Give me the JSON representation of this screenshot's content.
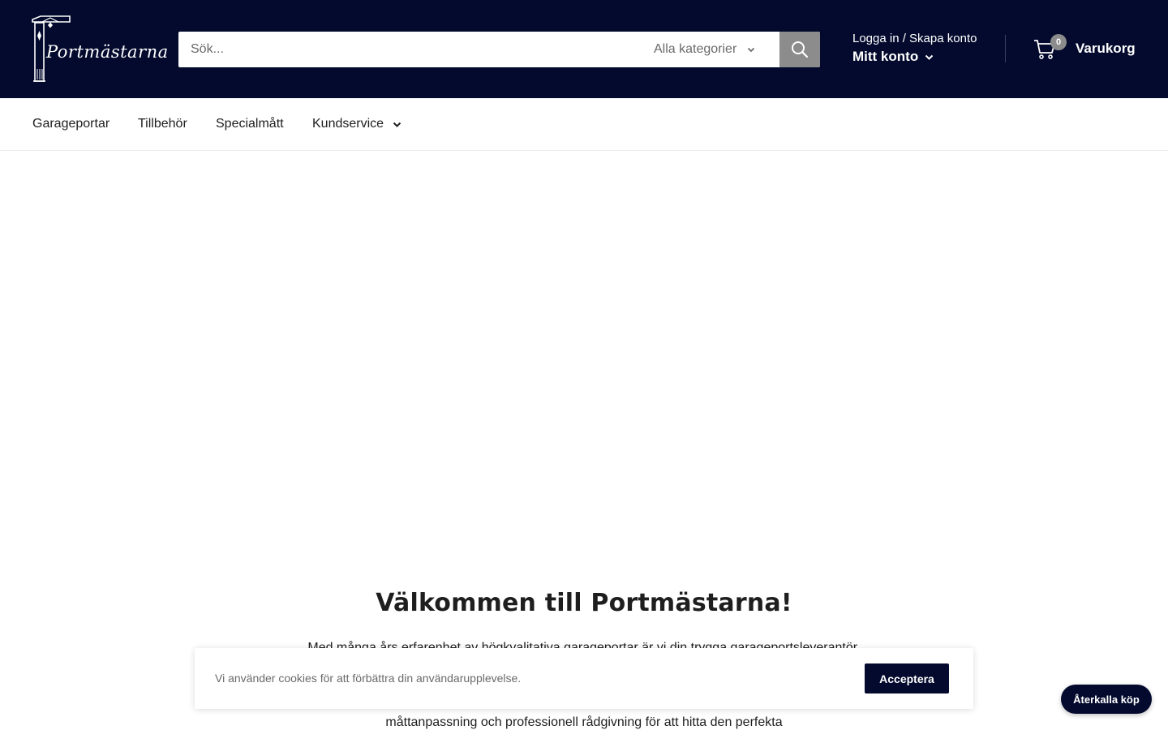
{
  "header": {
    "logo_text": "Portmästarna",
    "search": {
      "placeholder": "Sök...",
      "category_label": "Alla kategorier"
    },
    "account": {
      "login_text": "Logga in / Skapa konto",
      "account_label": "Mitt konto"
    },
    "cart": {
      "count": "0",
      "label": "Varukorg"
    }
  },
  "nav": {
    "items": [
      {
        "label": "Garageportar"
      },
      {
        "label": "Tillbehör"
      },
      {
        "label": "Specialmått"
      },
      {
        "label": "Kundservice"
      }
    ]
  },
  "main": {
    "welcome_title": "Välkommen till Portmästarna!",
    "intro_line_1": "Med många års erfarenhet av högkvalitativa garageportar är vi din trygga garageportsleverantör.",
    "intro_line_2": "måttanpassning och professionell rådgivning för att hitta den perfekta"
  },
  "cookie_banner": {
    "text": "Vi använder cookies för att förbättra din användarupplevelse.",
    "accept_label": "Acceptera"
  },
  "floating": {
    "recall_label": "Återkalla köp"
  },
  "colors": {
    "header_bg": "#030a2d",
    "search_button_bg": "#8c8c8c",
    "accent_button": "#030a2d"
  }
}
